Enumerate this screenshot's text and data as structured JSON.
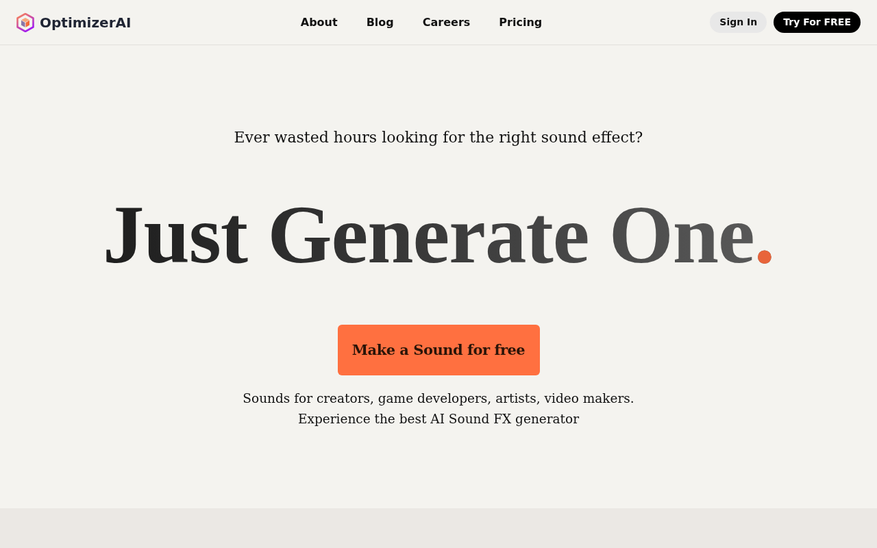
{
  "header": {
    "logo": "OptimizerAI",
    "nav": [
      "About",
      "Blog",
      "Careers",
      "Pricing"
    ],
    "actions": [
      {
        "label": "Sign In",
        "kind": "secondary"
      },
      {
        "label": "Try For FREE",
        "kind": "primary"
      }
    ]
  },
  "hero": {
    "question": "Ever wasted hours looking for the right sound effect?",
    "headline": {
      "text": "Just Generate One",
      "accent": "."
    },
    "cta": "Make a Sound for free",
    "description": [
      "Sounds for creators, game developers, artists, video makers.",
      "Experience the best AI Sound FX generator"
    ]
  }
}
